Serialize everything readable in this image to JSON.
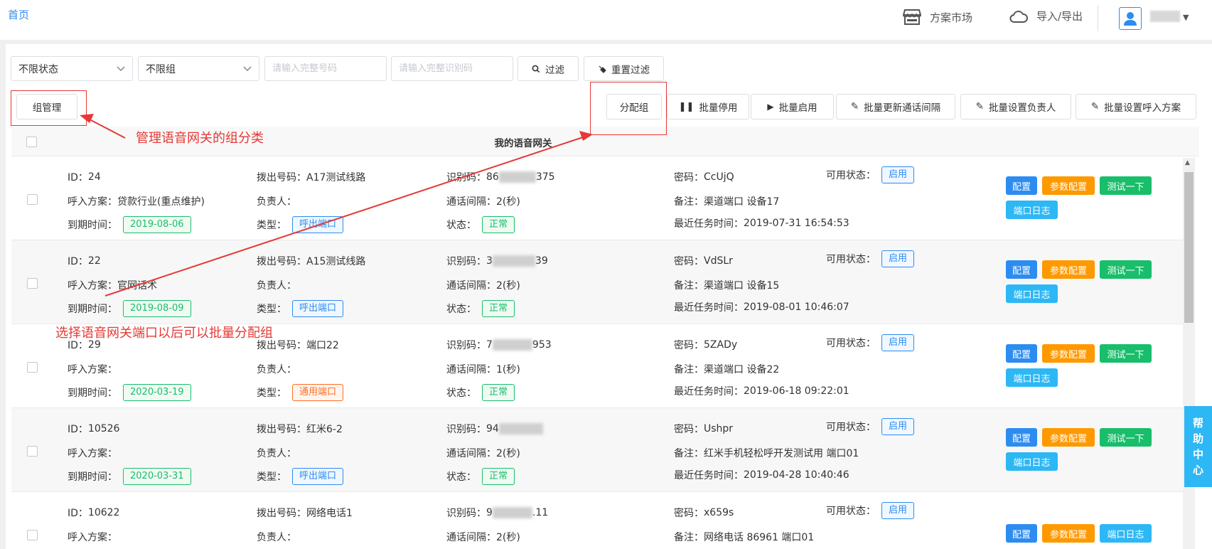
{
  "topbar": {
    "home": "首页",
    "market": "方案市场",
    "import_export": "导入/导出"
  },
  "filters": {
    "status_select": "不限状态",
    "group_select": "不限组",
    "number_placeholder": "请输入完整号码",
    "code_placeholder": "请输入完整识别码",
    "filter_label": "过滤",
    "reset_label": "重置过滤"
  },
  "toolbar": {
    "group_manage": "组管理",
    "assign_group": "分配组",
    "batch_stop": "批量停用",
    "batch_start": "批量启用",
    "batch_interval": "批量更新通话间隔",
    "batch_owner": "批量设置负责人",
    "batch_plan": "批量设置呼入方案"
  },
  "annotations": {
    "group_note": "管理语音网关的组分类",
    "assign_note": "选择语音网关端口以后可以批量分配组"
  },
  "table": {
    "title": "我的语音网关",
    "labels": {
      "id": "ID：",
      "plan": "呼入方案：",
      "expire": "到期时间：",
      "dial": "拨出号码：",
      "owner": "负责人：",
      "type": "类型：",
      "code": "识别码：",
      "interval": "通话间隔：",
      "state": "状态：",
      "pwd": "密码：",
      "remark": "备注：",
      "last_task": "最近任务时间：",
      "avail": "可用状态："
    },
    "actions": {
      "config": "配置",
      "param_config": "参数配置",
      "test": "测试一下",
      "log": "端口日志"
    },
    "rows": [
      {
        "id": "24",
        "plan": "贷款行业(重点维护)",
        "expire": "2019-08-06",
        "dial": "A17测试线路",
        "owner": "",
        "type": "呼出端口",
        "code_pre": "86",
        "code_suf": "375",
        "interval": "2(秒)",
        "state": "正常",
        "pwd": "CcUjQ",
        "remark": "渠道端口 设备17",
        "last_task": "2019-07-31 16:54:53",
        "avail": "启用"
      },
      {
        "id": "22",
        "plan": "官网话术",
        "expire": "2019-08-09",
        "dial": "A15测试线路",
        "owner": "",
        "type": "呼出端口",
        "code_pre": "3",
        "code_suf": "39",
        "interval": "2(秒)",
        "state": "正常",
        "pwd": "VdSLr",
        "remark": "渠道端口 设备15",
        "last_task": "2019-08-01 10:46:07",
        "avail": "启用"
      },
      {
        "id": "29",
        "plan": "",
        "expire": "2020-03-19",
        "dial": "端口22",
        "owner": "",
        "type": "通用端口",
        "code_pre": "7",
        "code_suf": "953",
        "interval": "1(秒)",
        "state": "正常",
        "pwd": "5ZADy",
        "remark": "渠道端口 设备22",
        "last_task": "2019-06-18 09:22:01",
        "avail": "启用"
      },
      {
        "id": "10526",
        "plan": "",
        "expire": "2020-03-31",
        "dial": "红米6-2",
        "owner": "",
        "type": "呼出端口",
        "code_pre": "94",
        "code_suf": "",
        "interval": "2(秒)",
        "state": "正常",
        "pwd": "Ushpr",
        "remark": "红米手机轻松呼开发测试用 端口01",
        "last_task": "2019-04-28 10:40:46",
        "avail": "启用"
      },
      {
        "id": "10622",
        "plan": "",
        "expire": "",
        "dial": "网络电话1",
        "owner": "",
        "type": "",
        "code_pre": "9",
        "code_suf": ".11",
        "interval": "2(秒)",
        "state": "",
        "pwd": "x659s",
        "remark": "网络电话 86961 端口01",
        "last_task": "",
        "avail": "启用"
      }
    ]
  },
  "help": [
    "帮",
    "助",
    "中",
    "心"
  ]
}
